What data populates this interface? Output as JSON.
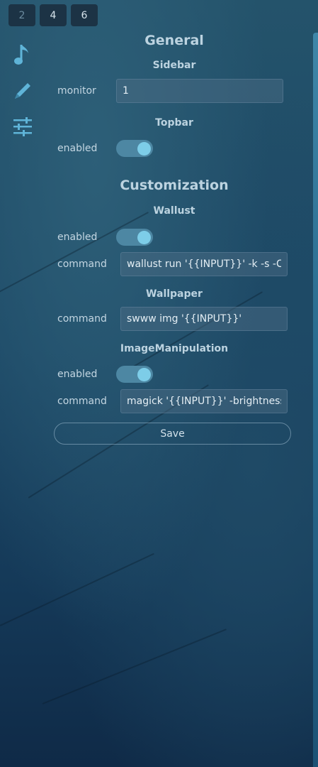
{
  "workspaces": [
    {
      "label": "2",
      "active": false
    },
    {
      "label": "4",
      "active": true
    },
    {
      "label": "6",
      "active": true
    }
  ],
  "sidebar_icons": [
    "music-note-icon",
    "pencil-icon",
    "sliders-icon"
  ],
  "general": {
    "title": "General",
    "sidebar": {
      "title": "Sidebar",
      "monitor_label": "monitor",
      "monitor_value": "1"
    },
    "topbar": {
      "title": "Topbar",
      "enabled_label": "enabled",
      "enabled": true
    }
  },
  "customization": {
    "title": "Customization",
    "wallust": {
      "title": "Wallust",
      "enabled_label": "enabled",
      "enabled": true,
      "command_label": "command",
      "command_value": "wallust run '{{INPUT}}' -k -s -C '{{C"
    },
    "wallpaper": {
      "title": "Wallpaper",
      "command_label": "command",
      "command_value": "swww img '{{INPUT}}'"
    },
    "image_manipulation": {
      "title": "ImageManipulation",
      "enabled_label": "enabled",
      "enabled": true,
      "command_label": "command",
      "command_value": "magick '{{INPUT}}' -brightness-co"
    }
  },
  "save_label": "Save",
  "colors": {
    "toggle_on": "#4d87a3",
    "knob": "#7dcde8",
    "workspace_bg": "#1c3345",
    "accent_icon": "#5fb4d8"
  }
}
